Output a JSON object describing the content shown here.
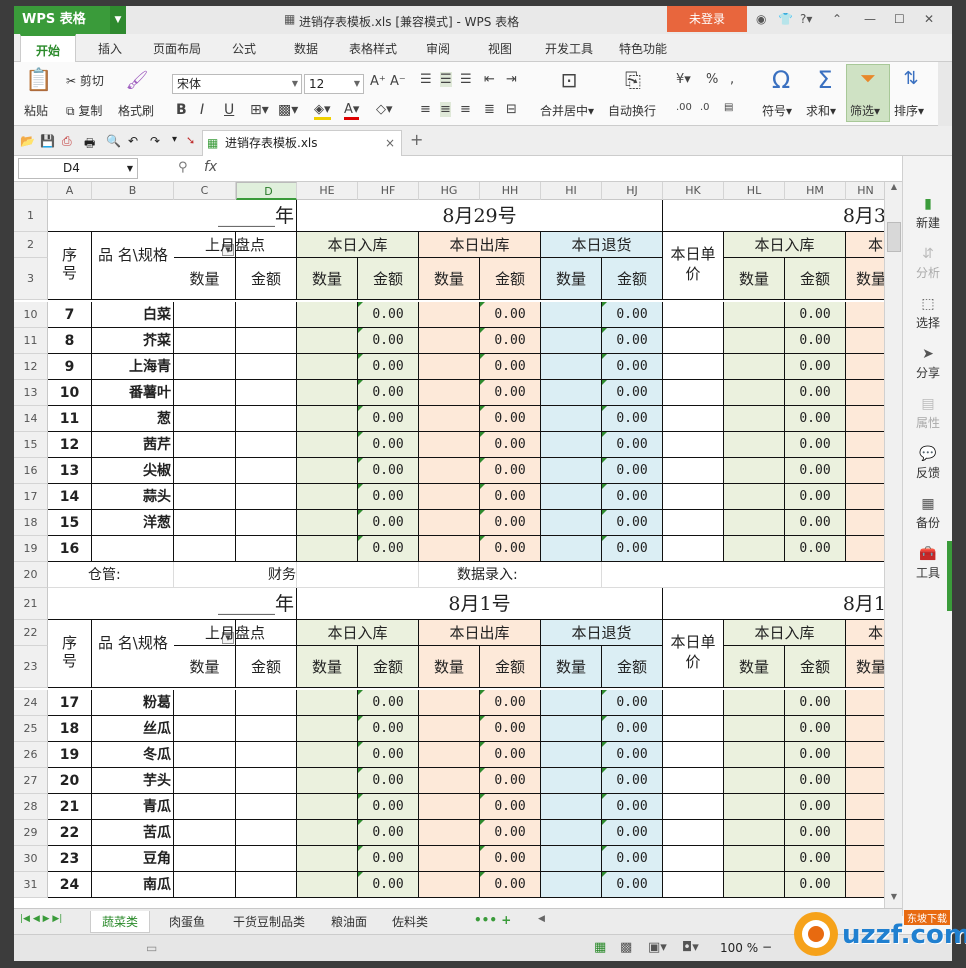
{
  "window": {
    "app_button": "WPS 表格",
    "title": "进销存表模板.xls [兼容模式] - WPS 表格",
    "login": "未登录"
  },
  "menu_tabs": [
    "开始",
    "插入",
    "页面布局",
    "公式",
    "数据",
    "表格样式",
    "审阅",
    "视图",
    "开发工具",
    "特色功能"
  ],
  "ribbon": {
    "paste": "粘贴",
    "cut": "剪切",
    "copy": "复制",
    "format_painter": "格式刷",
    "font_name": "宋体",
    "font_size": "12",
    "merge_center": "合并居中",
    "wrap_text": "自动换行",
    "symbol": "符号",
    "sum": "求和",
    "filter": "筛选",
    "sort": "排序"
  },
  "doc_tab": "进销存表模板.xls",
  "formula_bar": {
    "cell_ref": "D4",
    "fx": "fx"
  },
  "right_pane": [
    {
      "label": "新建",
      "icon": "new-doc-icon",
      "enabled": true
    },
    {
      "label": "分析",
      "icon": "analyze-icon",
      "enabled": false
    },
    {
      "label": "选择",
      "icon": "select-icon",
      "enabled": true
    },
    {
      "label": "分享",
      "icon": "share-icon",
      "enabled": true
    },
    {
      "label": "属性",
      "icon": "property-icon",
      "enabled": false
    },
    {
      "label": "反馈",
      "icon": "feedback-icon",
      "enabled": true
    },
    {
      "label": "备份",
      "icon": "backup-icon",
      "enabled": true
    },
    {
      "label": "工具",
      "icon": "toolbox-icon",
      "enabled": true
    }
  ],
  "columns": [
    "A",
    "B",
    "C",
    "D",
    "HE",
    "HF",
    "HG",
    "HH",
    "HI",
    "HJ",
    "HK",
    "HL",
    "HM",
    "HN"
  ],
  "selected_column": "D",
  "sheet": {
    "block1": {
      "row_labels": [
        "1",
        "2",
        "3"
      ],
      "year_label": "______年",
      "date1": "8月29号",
      "date2": "8月3",
      "items_rows": [
        "10",
        "11",
        "12",
        "13",
        "14",
        "15",
        "16",
        "17",
        "18",
        "19"
      ],
      "items": [
        {
          "no": "7",
          "name": "白菜"
        },
        {
          "no": "8",
          "name": "芥菜"
        },
        {
          "no": "9",
          "name": "上海青"
        },
        {
          "no": "10",
          "name": "番薯叶"
        },
        {
          "no": "11",
          "name": "葱"
        },
        {
          "no": "12",
          "name": "茜芹"
        },
        {
          "no": "13",
          "name": "尖椒"
        },
        {
          "no": "14",
          "name": "蒜头"
        },
        {
          "no": "15",
          "name": "洋葱"
        },
        {
          "no": "16",
          "name": ""
        }
      ]
    },
    "footer_row": "20",
    "footer": {
      "warehouse": "仓管:",
      "finance": "财务",
      "data_entry": "数据录入:"
    },
    "block2": {
      "row_labels": [
        "21",
        "22",
        "23"
      ],
      "year_label": "______年",
      "date1": "8月1号",
      "date2": "8月1",
      "items_rows": [
        "24",
        "25",
        "26",
        "27",
        "28",
        "29",
        "30",
        "31"
      ],
      "items": [
        {
          "no": "17",
          "name": "粉葛"
        },
        {
          "no": "18",
          "name": "丝瓜"
        },
        {
          "no": "19",
          "name": "冬瓜"
        },
        {
          "no": "20",
          "name": "芋头"
        },
        {
          "no": "21",
          "name": "青瓜"
        },
        {
          "no": "22",
          "name": "苦瓜"
        },
        {
          "no": "23",
          "name": "豆角"
        },
        {
          "no": "24",
          "name": "南瓜"
        }
      ]
    },
    "headers": {
      "seq": "序号",
      "name": "品 名\\规格",
      "last_month": "上月盘点",
      "in": "本日入库",
      "out": "本日出库",
      "ret": "本日退货",
      "unit_price": "本日单价",
      "in2": "本日入库",
      "partial": "本",
      "qty": "数量",
      "amount": "金额",
      "qty_partial": "数量"
    },
    "zero": "0.00"
  },
  "sheet_tabs": [
    "蔬菜类",
    "肉蛋鱼",
    "干货豆制品类",
    "粮油面",
    "佐料类"
  ],
  "active_sheet": "蔬菜类",
  "status": {
    "zoom": "100 %"
  },
  "watermark": {
    "brand": "uzzf.com",
    "sub": "东坡下载"
  },
  "colors": {
    "green": "#ebf1de",
    "orange": "#fde9d9",
    "blue": "#dbeef4",
    "accent": "#3a9b3a",
    "login": "#e8663d"
  }
}
